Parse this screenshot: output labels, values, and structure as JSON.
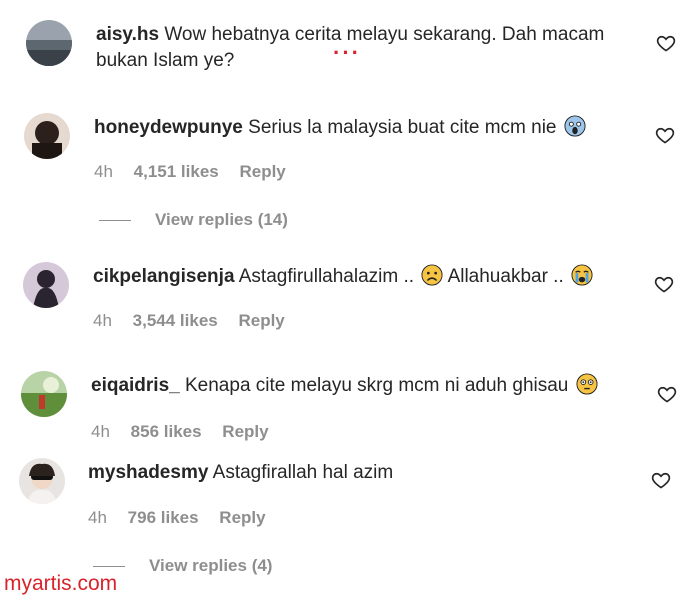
{
  "comments": [
    {
      "username": "aisy.hs",
      "text": "Wow hebatnya cerita melayu sekarang. Dah macam bukan Islam ye?"
    },
    {
      "username": "honeydewpunye",
      "text": "Serius la malaysia buat cite mcm nie",
      "time": "4h",
      "likes": "4,151 likes",
      "reply": "Reply",
      "view_replies": "View replies (14)"
    },
    {
      "username": "cikpelangisenja",
      "text": "Astagfirullahalazim ..",
      "text2": "Allahuakbar ..",
      "time": "4h",
      "likes": "3,544 likes",
      "reply": "Reply"
    },
    {
      "username": "eiqaidris_",
      "text": "Kenapa cite melayu skrg mcm ni aduh ghisau",
      "time": "4h",
      "likes": "856 likes",
      "reply": "Reply"
    },
    {
      "username": "myshadesmy",
      "text": "Astagfirallah hal azim",
      "time": "4h",
      "likes": "796 likes",
      "reply": "Reply",
      "view_replies": "View replies (4)"
    }
  ],
  "watermark": "myartis.com"
}
